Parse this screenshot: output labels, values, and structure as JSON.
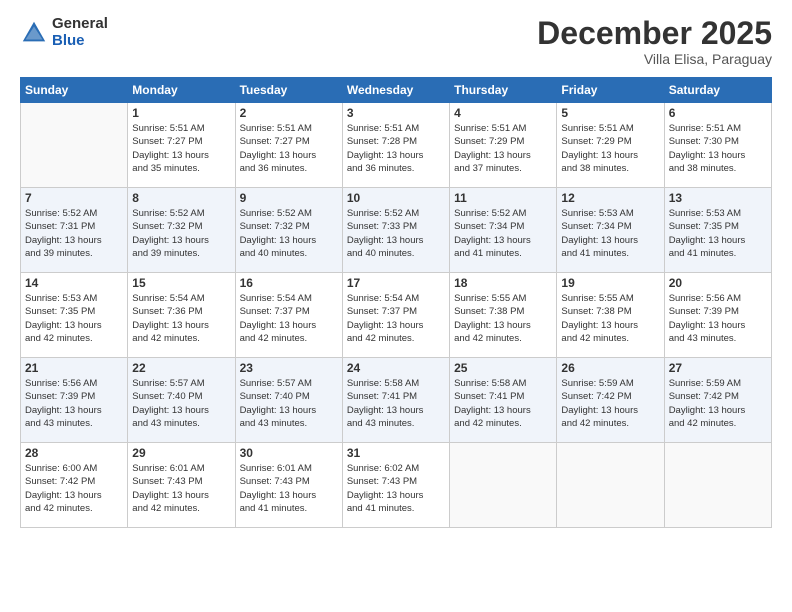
{
  "header": {
    "logo_general": "General",
    "logo_blue": "Blue",
    "month_title": "December 2025",
    "subtitle": "Villa Elisa, Paraguay"
  },
  "days_of_week": [
    "Sunday",
    "Monday",
    "Tuesday",
    "Wednesday",
    "Thursday",
    "Friday",
    "Saturday"
  ],
  "weeks": [
    [
      {
        "day": "",
        "info": ""
      },
      {
        "day": "1",
        "info": "Sunrise: 5:51 AM\nSunset: 7:27 PM\nDaylight: 13 hours\nand 35 minutes."
      },
      {
        "day": "2",
        "info": "Sunrise: 5:51 AM\nSunset: 7:27 PM\nDaylight: 13 hours\nand 36 minutes."
      },
      {
        "day": "3",
        "info": "Sunrise: 5:51 AM\nSunset: 7:28 PM\nDaylight: 13 hours\nand 36 minutes."
      },
      {
        "day": "4",
        "info": "Sunrise: 5:51 AM\nSunset: 7:29 PM\nDaylight: 13 hours\nand 37 minutes."
      },
      {
        "day": "5",
        "info": "Sunrise: 5:51 AM\nSunset: 7:29 PM\nDaylight: 13 hours\nand 38 minutes."
      },
      {
        "day": "6",
        "info": "Sunrise: 5:51 AM\nSunset: 7:30 PM\nDaylight: 13 hours\nand 38 minutes."
      }
    ],
    [
      {
        "day": "7",
        "info": "Sunrise: 5:52 AM\nSunset: 7:31 PM\nDaylight: 13 hours\nand 39 minutes."
      },
      {
        "day": "8",
        "info": "Sunrise: 5:52 AM\nSunset: 7:32 PM\nDaylight: 13 hours\nand 39 minutes."
      },
      {
        "day": "9",
        "info": "Sunrise: 5:52 AM\nSunset: 7:32 PM\nDaylight: 13 hours\nand 40 minutes."
      },
      {
        "day": "10",
        "info": "Sunrise: 5:52 AM\nSunset: 7:33 PM\nDaylight: 13 hours\nand 40 minutes."
      },
      {
        "day": "11",
        "info": "Sunrise: 5:52 AM\nSunset: 7:34 PM\nDaylight: 13 hours\nand 41 minutes."
      },
      {
        "day": "12",
        "info": "Sunrise: 5:53 AM\nSunset: 7:34 PM\nDaylight: 13 hours\nand 41 minutes."
      },
      {
        "day": "13",
        "info": "Sunrise: 5:53 AM\nSunset: 7:35 PM\nDaylight: 13 hours\nand 41 minutes."
      }
    ],
    [
      {
        "day": "14",
        "info": "Sunrise: 5:53 AM\nSunset: 7:35 PM\nDaylight: 13 hours\nand 42 minutes."
      },
      {
        "day": "15",
        "info": "Sunrise: 5:54 AM\nSunset: 7:36 PM\nDaylight: 13 hours\nand 42 minutes."
      },
      {
        "day": "16",
        "info": "Sunrise: 5:54 AM\nSunset: 7:37 PM\nDaylight: 13 hours\nand 42 minutes."
      },
      {
        "day": "17",
        "info": "Sunrise: 5:54 AM\nSunset: 7:37 PM\nDaylight: 13 hours\nand 42 minutes."
      },
      {
        "day": "18",
        "info": "Sunrise: 5:55 AM\nSunset: 7:38 PM\nDaylight: 13 hours\nand 42 minutes."
      },
      {
        "day": "19",
        "info": "Sunrise: 5:55 AM\nSunset: 7:38 PM\nDaylight: 13 hours\nand 42 minutes."
      },
      {
        "day": "20",
        "info": "Sunrise: 5:56 AM\nSunset: 7:39 PM\nDaylight: 13 hours\nand 43 minutes."
      }
    ],
    [
      {
        "day": "21",
        "info": "Sunrise: 5:56 AM\nSunset: 7:39 PM\nDaylight: 13 hours\nand 43 minutes."
      },
      {
        "day": "22",
        "info": "Sunrise: 5:57 AM\nSunset: 7:40 PM\nDaylight: 13 hours\nand 43 minutes."
      },
      {
        "day": "23",
        "info": "Sunrise: 5:57 AM\nSunset: 7:40 PM\nDaylight: 13 hours\nand 43 minutes."
      },
      {
        "day": "24",
        "info": "Sunrise: 5:58 AM\nSunset: 7:41 PM\nDaylight: 13 hours\nand 43 minutes."
      },
      {
        "day": "25",
        "info": "Sunrise: 5:58 AM\nSunset: 7:41 PM\nDaylight: 13 hours\nand 42 minutes."
      },
      {
        "day": "26",
        "info": "Sunrise: 5:59 AM\nSunset: 7:42 PM\nDaylight: 13 hours\nand 42 minutes."
      },
      {
        "day": "27",
        "info": "Sunrise: 5:59 AM\nSunset: 7:42 PM\nDaylight: 13 hours\nand 42 minutes."
      }
    ],
    [
      {
        "day": "28",
        "info": "Sunrise: 6:00 AM\nSunset: 7:42 PM\nDaylight: 13 hours\nand 42 minutes."
      },
      {
        "day": "29",
        "info": "Sunrise: 6:01 AM\nSunset: 7:43 PM\nDaylight: 13 hours\nand 42 minutes."
      },
      {
        "day": "30",
        "info": "Sunrise: 6:01 AM\nSunset: 7:43 PM\nDaylight: 13 hours\nand 41 minutes."
      },
      {
        "day": "31",
        "info": "Sunrise: 6:02 AM\nSunset: 7:43 PM\nDaylight: 13 hours\nand 41 minutes."
      },
      {
        "day": "",
        "info": ""
      },
      {
        "day": "",
        "info": ""
      },
      {
        "day": "",
        "info": ""
      }
    ]
  ]
}
